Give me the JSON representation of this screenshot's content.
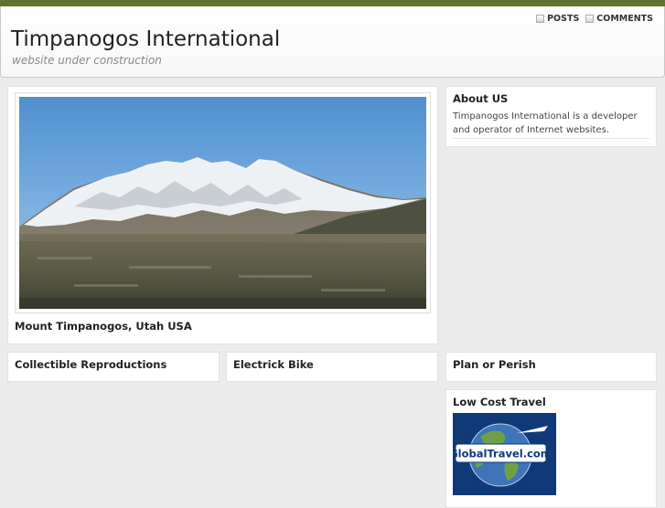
{
  "header": {
    "site_title": "Timpanogos International",
    "tagline": "website under construction",
    "feeds": [
      {
        "label": "POSTS",
        "icon": "rss-feed-icon"
      },
      {
        "label": "COMMENTS",
        "icon": "rss-feed-icon"
      }
    ]
  },
  "featured": {
    "caption": "Mount Timpanogos, Utah USA",
    "image": "mountain-photo"
  },
  "about": {
    "title": "About US",
    "text": "Timpanogos International is a developer and operator of Internet websites."
  },
  "boxes": [
    {
      "title": "Collectible Reproductions"
    },
    {
      "title": "Electrick Bike"
    },
    {
      "title": "Plan or Perish"
    }
  ],
  "travel": {
    "title": "Low Cost Travel",
    "logo_text": "GlobalTravel.com"
  },
  "colors": {
    "topbar": "#5e7433",
    "background": "#ebebeb",
    "logo_blue": "#0f3a77"
  }
}
